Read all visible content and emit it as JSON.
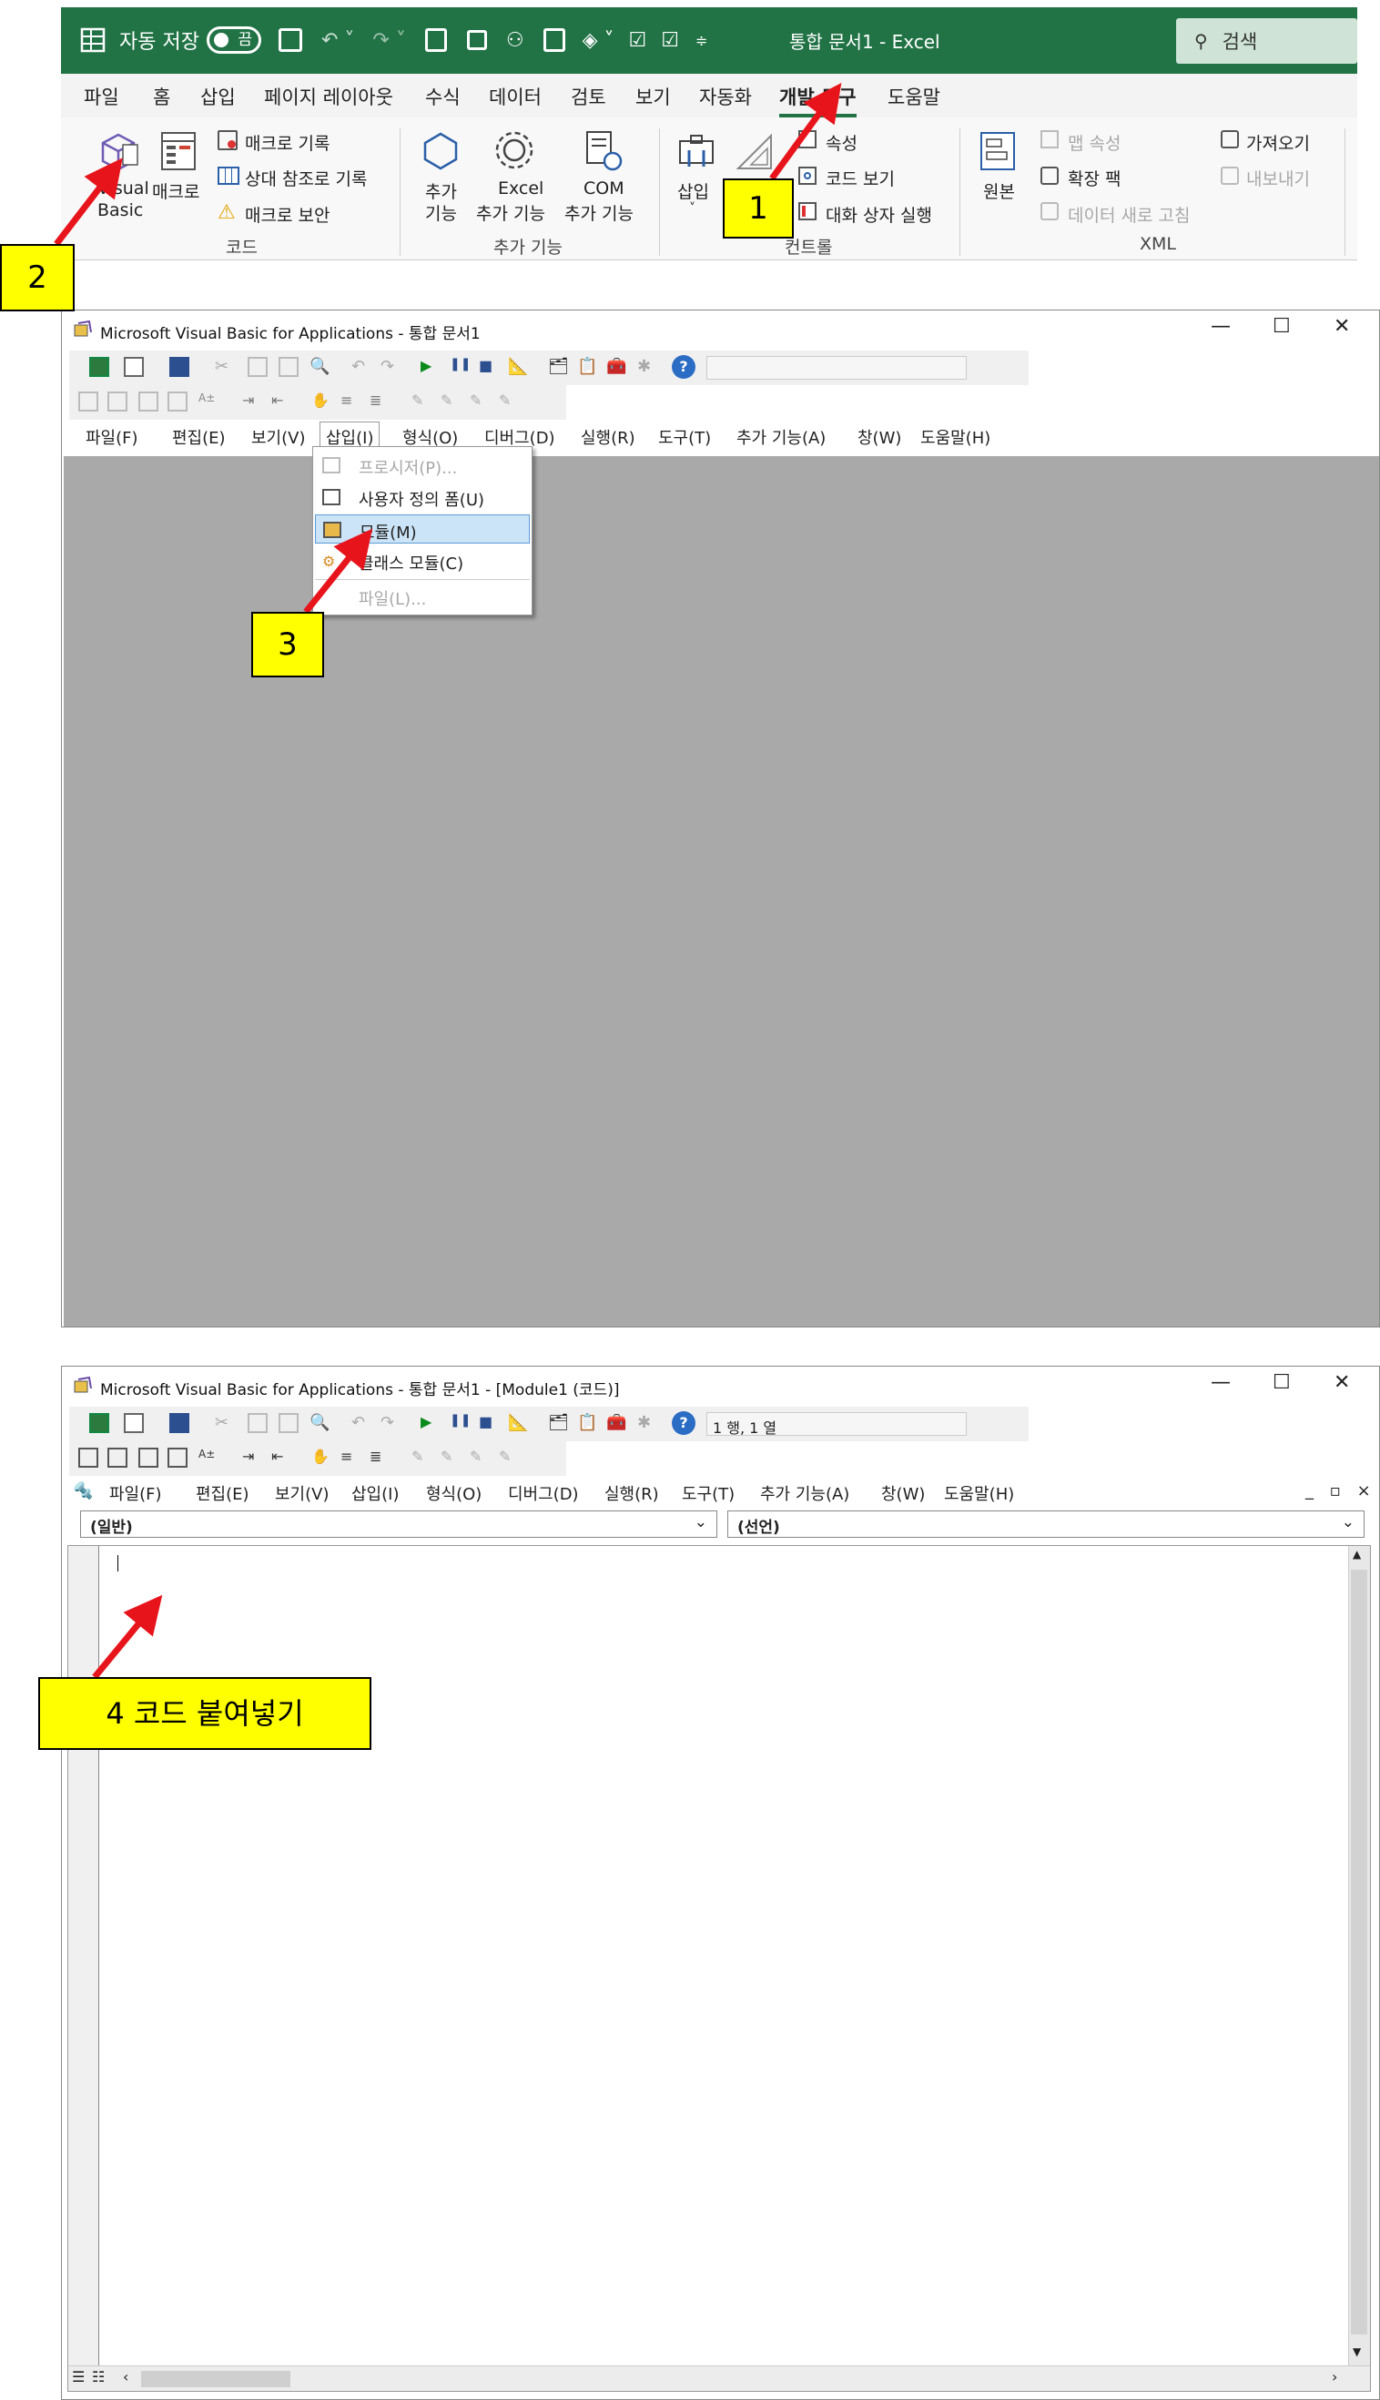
{
  "excel": {
    "autosave_label": "자동 저장",
    "autosave_state": "끔",
    "title": "통합 문서1  -  Excel",
    "search_placeholder": "검색",
    "tabs": [
      "파일",
      "홈",
      "삽입",
      "페이지 레이아웃",
      "수식",
      "데이터",
      "검토",
      "보기",
      "자동화",
      "개발 도구",
      "도움말"
    ],
    "active_tab": "개발 도구",
    "ribbon": {
      "vb_label_1": "Visual",
      "vb_label_2": "Basic",
      "macro_label": "매크로",
      "record_macro": "매크로 기록",
      "relative_ref": "상대 참조로 기록",
      "macro_security": "매크로 보안",
      "group_code": "코드",
      "addin_label_1": "추가",
      "addin_label_2": "기능",
      "excel_addin_1": "Excel",
      "excel_addin_2": "추가 기능",
      "com_addin_1": "COM",
      "com_addin_2": "추가 기능",
      "group_addins": "추가 기능",
      "insert_label": "삽입",
      "properties": "속성",
      "view_code": "코드 보기",
      "run_dialog": "대화 상자 실행",
      "group_controls": "컨트롤",
      "source": "원본",
      "map_properties": "맵 속성",
      "expansion_packs": "확장 팩",
      "refresh_data": "데이터 새로 고침",
      "import": "가져오기",
      "export": "내보내기",
      "group_xml": "XML"
    }
  },
  "vba1": {
    "title": "Microsoft Visual Basic for Applications - 통합 문서1",
    "menu": [
      "파일(F)",
      "편집(E)",
      "보기(V)",
      "삽입(I)",
      "형식(O)",
      "디버그(D)",
      "실행(R)",
      "도구(T)",
      "추가 기능(A)",
      "창(W)",
      "도움말(H)"
    ],
    "dropdown": [
      "프로시저(P)...",
      "사용자 정의 폼(U)",
      "모듈(M)",
      "클래스 모듈(C)",
      "파일(L)..."
    ]
  },
  "vba2": {
    "title": "Microsoft Visual Basic for Applications - 통합 문서1 - [Module1 (코드)]",
    "position": "1 행, 1 열",
    "menu": [
      "파일(F)",
      "편집(E)",
      "보기(V)",
      "삽입(I)",
      "형식(O)",
      "디버그(D)",
      "실행(R)",
      "도구(T)",
      "추가 기능(A)",
      "창(W)",
      "도움말(H)"
    ],
    "object_select": "(일반)",
    "proc_select": "(선언)",
    "mdi_controls": "_ ▫ ×"
  },
  "callouts": {
    "c1": "1",
    "c2": "2",
    "c3": "3",
    "c4": "4 코드 붙여넣기"
  },
  "colors": {
    "excel_green": "#217346",
    "callout_yellow": "#ffff00",
    "arrow_red": "#e8141b",
    "mdi_gray": "#a9a9a9",
    "menu_highlight": "#cce4f7"
  }
}
